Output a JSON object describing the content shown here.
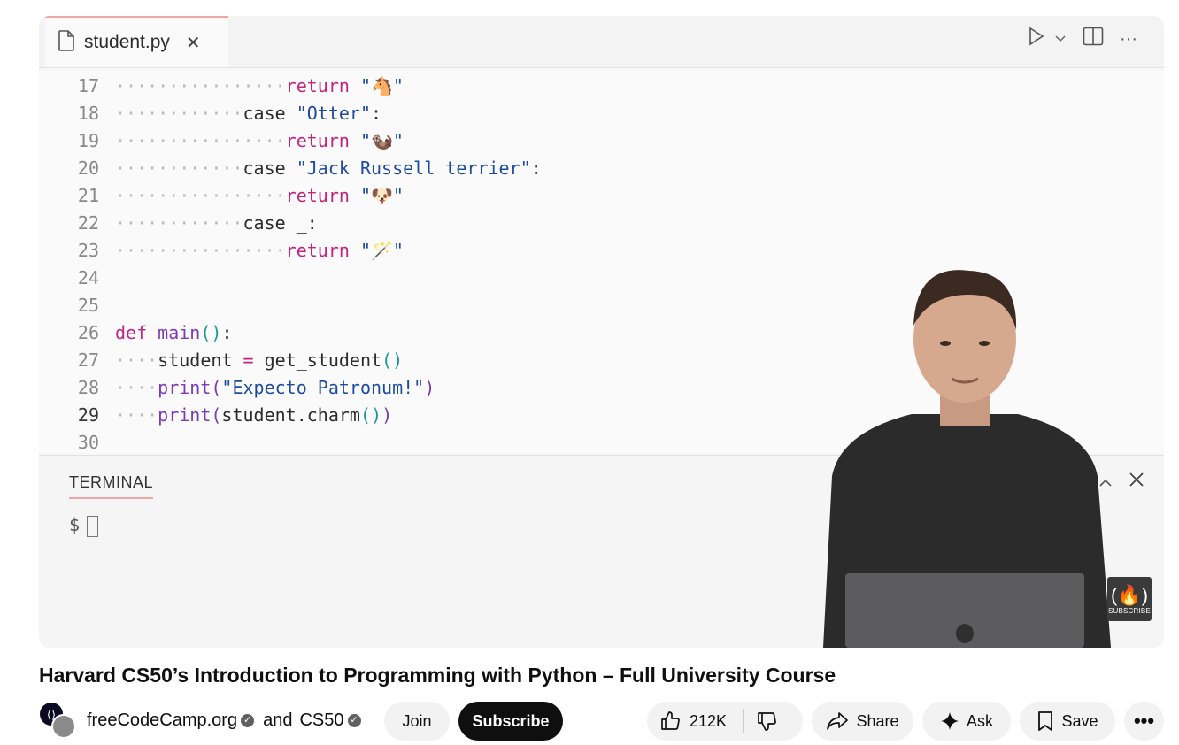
{
  "editor": {
    "tab_name": "student.py",
    "tab_close": "✕",
    "lines": [
      {
        "num": "17",
        "indent": "················",
        "parts": [
          {
            "t": "return",
            "c": "kw"
          },
          {
            "t": " \"🐴\"",
            "c": "str"
          }
        ]
      },
      {
        "num": "18",
        "indent": "············",
        "parts": [
          {
            "t": "case ",
            "c": ""
          },
          {
            "t": "\"Otter\"",
            "c": "str"
          },
          {
            "t": ":",
            "c": ""
          }
        ]
      },
      {
        "num": "19",
        "indent": "················",
        "parts": [
          {
            "t": "return",
            "c": "kw"
          },
          {
            "t": " \"🦦\"",
            "c": "str"
          }
        ]
      },
      {
        "num": "20",
        "indent": "············",
        "parts": [
          {
            "t": "case ",
            "c": ""
          },
          {
            "t": "\"Jack Russell terrier\"",
            "c": "str"
          },
          {
            "t": ":",
            "c": ""
          }
        ]
      },
      {
        "num": "21",
        "indent": "················",
        "parts": [
          {
            "t": "return",
            "c": "kw"
          },
          {
            "t": " \"🐶\"",
            "c": "str"
          }
        ]
      },
      {
        "num": "22",
        "indent": "············",
        "parts": [
          {
            "t": "case _:",
            "c": ""
          }
        ]
      },
      {
        "num": "23",
        "indent": "················",
        "parts": [
          {
            "t": "return",
            "c": "kw"
          },
          {
            "t": " \"🪄\"",
            "c": "str"
          }
        ]
      },
      {
        "num": "24",
        "indent": "",
        "parts": []
      },
      {
        "num": "25",
        "indent": "",
        "parts": []
      },
      {
        "num": "26",
        "indent": "",
        "parts": [
          {
            "t": "def ",
            "c": "kw"
          },
          {
            "t": "main",
            "c": "fn"
          },
          {
            "t": "()",
            "c": "par"
          },
          {
            "t": ":",
            "c": ""
          }
        ]
      },
      {
        "num": "27",
        "indent": "····",
        "parts": [
          {
            "t": "student ",
            "c": ""
          },
          {
            "t": "=",
            "c": "op"
          },
          {
            "t": " get_student",
            "c": ""
          },
          {
            "t": "()",
            "c": "par"
          }
        ]
      },
      {
        "num": "28",
        "indent": "····",
        "parts": [
          {
            "t": "print(",
            "c": "fn"
          },
          {
            "t": "\"Expecto Patronum!\"",
            "c": "str"
          },
          {
            "t": ")",
            "c": "fn"
          }
        ]
      },
      {
        "num": "29",
        "indent": "····",
        "parts": [
          {
            "t": "print(",
            "c": "fn"
          },
          {
            "t": "student.charm",
            "c": ""
          },
          {
            "t": "()",
            "c": "par"
          },
          {
            "t": ")",
            "c": "fn"
          }
        ]
      },
      {
        "num": "30",
        "indent": "",
        "parts": []
      }
    ]
  },
  "terminal": {
    "title": "TERMINAL",
    "prompt": "$"
  },
  "watermark": {
    "label": "SUBSCRIBE"
  },
  "video": {
    "title": "Harvard CS50’s Introduction to Programming with Python – Full University Course"
  },
  "channel": {
    "name1": "freeCodeCamp.org",
    "and": "and",
    "name2": "CS50"
  },
  "actions": {
    "join": "Join",
    "subscribe": "Subscribe",
    "likes": "212K",
    "share": "Share",
    "ask": "Ask",
    "save": "Save"
  }
}
